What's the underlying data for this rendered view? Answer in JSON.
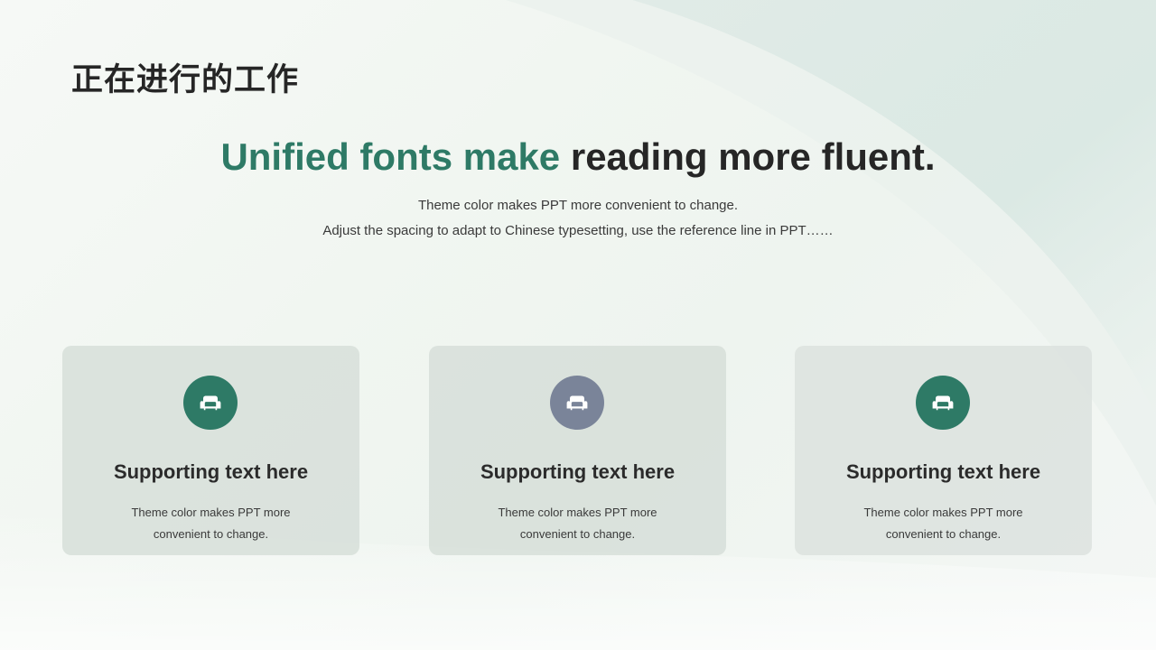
{
  "page_title": "正在进行的工作",
  "headline": {
    "accent": "Unified fonts make",
    "rest": "reading more fluent."
  },
  "subtitle": {
    "line1": "Theme color makes PPT more convenient  to change.",
    "line2": "Adjust the spacing to adapt to Chinese typesetting, use the reference line in PPT……"
  },
  "cards": [
    {
      "icon": "armchair-icon",
      "icon_color": "#2e7a66",
      "title": "Supporting text here",
      "desc_line1": "Theme  color makes PPT  more",
      "desc_line2": "convenient  to change."
    },
    {
      "icon": "armchair-icon",
      "icon_color": "#7a8499",
      "title": "Supporting text here",
      "desc_line1": "Theme  color makes PPT  more",
      "desc_line2": "convenient  to change."
    },
    {
      "icon": "armchair-icon",
      "icon_color": "#2e7a66",
      "title": "Supporting text here",
      "desc_line1": "Theme  color makes PPT  more",
      "desc_line2": "convenient  to change."
    }
  ],
  "colors": {
    "accent": "#2e7a66",
    "secondary": "#7a8499",
    "text_dark": "#262626"
  }
}
